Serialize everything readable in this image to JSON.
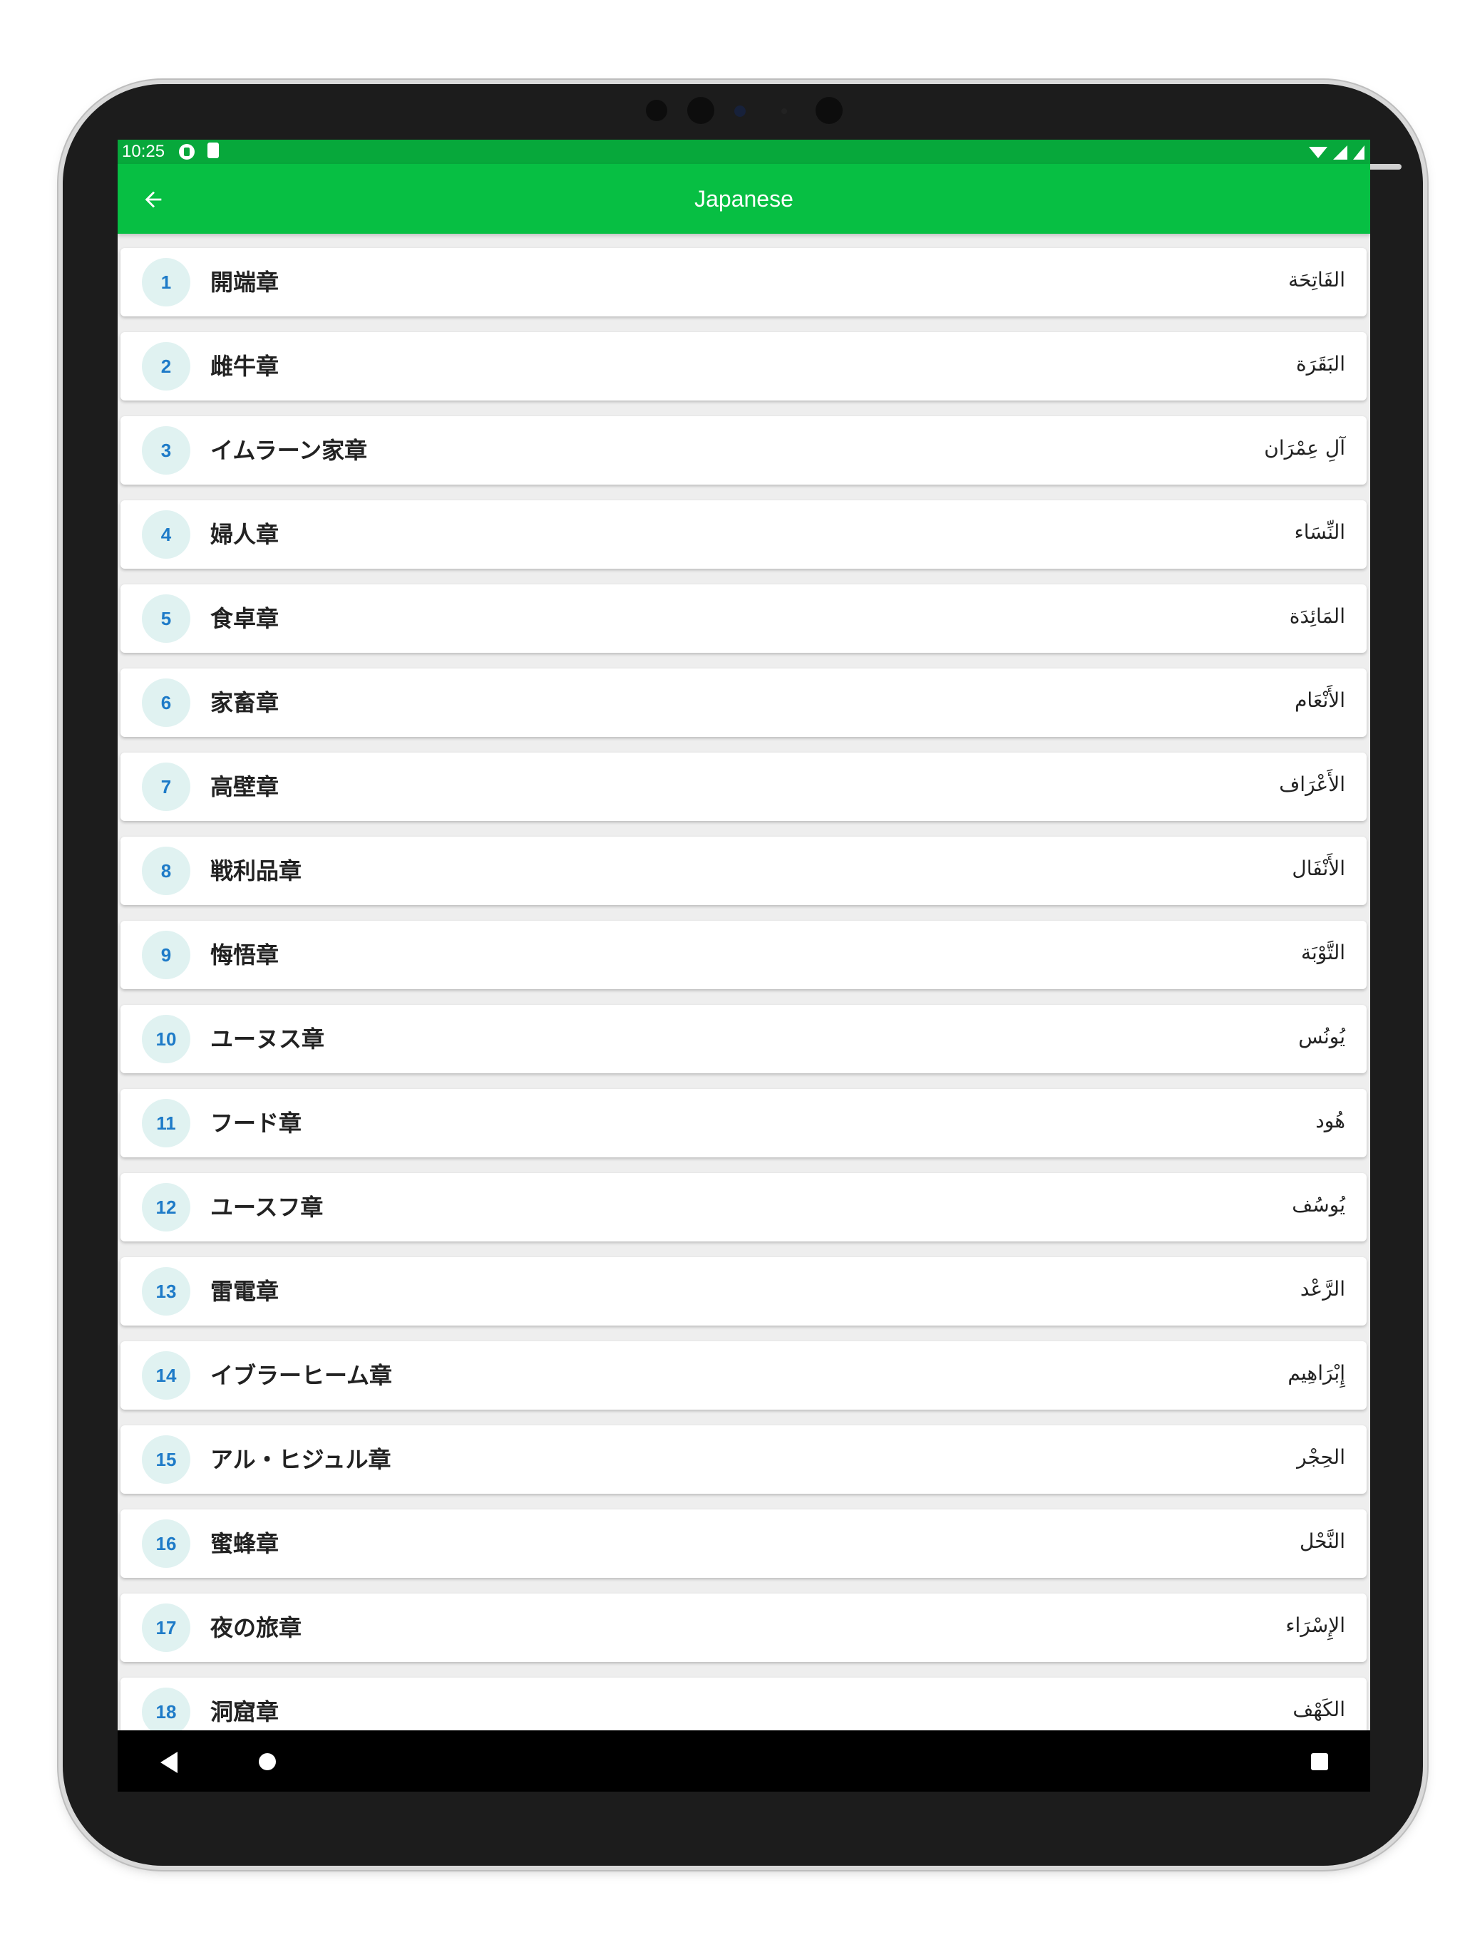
{
  "status_bar": {
    "time": "10:25"
  },
  "app_bar": {
    "title": "Japanese"
  },
  "chapters": [
    {
      "number": "1",
      "name_ja": "開端章",
      "name_ar": "الفَاتِحَة"
    },
    {
      "number": "2",
      "name_ja": "雌牛章",
      "name_ar": "البَقَرَة"
    },
    {
      "number": "3",
      "name_ja": "イムラーン家章",
      "name_ar": "آلِ عِمْرَان"
    },
    {
      "number": "4",
      "name_ja": "婦人章",
      "name_ar": "النِّسَاء"
    },
    {
      "number": "5",
      "name_ja": "食卓章",
      "name_ar": "المَائِدَة"
    },
    {
      "number": "6",
      "name_ja": "家畜章",
      "name_ar": "الأَنْعَام"
    },
    {
      "number": "7",
      "name_ja": "高壁章",
      "name_ar": "الأَعْرَاف"
    },
    {
      "number": "8",
      "name_ja": "戦利品章",
      "name_ar": "الأَنْفَال"
    },
    {
      "number": "9",
      "name_ja": "悔悟章",
      "name_ar": "التَّوْبَة"
    },
    {
      "number": "10",
      "name_ja": "ユーヌス章",
      "name_ar": "يُونُس"
    },
    {
      "number": "11",
      "name_ja": "フード章",
      "name_ar": "هُود"
    },
    {
      "number": "12",
      "name_ja": "ユースフ章",
      "name_ar": "يُوسُف"
    },
    {
      "number": "13",
      "name_ja": "雷電章",
      "name_ar": "الرَّعْد"
    },
    {
      "number": "14",
      "name_ja": "イブラーヒーム章",
      "name_ar": "إِبْرَاهِيم"
    },
    {
      "number": "15",
      "name_ja": "アル・ヒジュル章",
      "name_ar": "الحِجْر"
    },
    {
      "number": "16",
      "name_ja": "蜜蜂章",
      "name_ar": "النَّحْل"
    },
    {
      "number": "17",
      "name_ja": "夜の旅章",
      "name_ar": "الإِسْرَاء"
    },
    {
      "number": "18",
      "name_ja": "洞窟章",
      "name_ar": "الكَهْف"
    }
  ],
  "icons": {
    "back": "arrow-left-icon",
    "nav_back": "triangle-back-icon",
    "nav_home": "circle-home-icon",
    "nav_recents": "square-recents-icon"
  },
  "colors": {
    "app_bar": "#07bf43",
    "status_bar": "#07a83b",
    "number_text": "#1e7bc8",
    "number_circle": "#e0f2f1"
  }
}
